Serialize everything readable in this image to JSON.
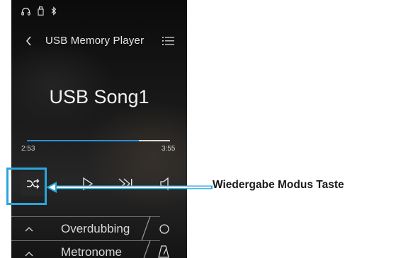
{
  "status_bar": {
    "icons": [
      "headphones-icon",
      "usb-icon",
      "bluetooth-icon"
    ]
  },
  "header": {
    "back_icon": "chevron-left-icon",
    "title": "USB Memory Player",
    "list_icon": "list-icon"
  },
  "song": {
    "title": "USB Song1"
  },
  "progress": {
    "elapsed": "2:53",
    "total": "3:55",
    "fraction": 0.78
  },
  "transport": {
    "mode_icon": "shuffle-icon",
    "play_icon": "play-icon",
    "forward_icon": "fast-forward-icon",
    "volume_icon": "speaker-icon"
  },
  "options": [
    {
      "label": "Overdubbing",
      "chevron": "chevron-up-icon",
      "icon": "record-circle-icon"
    },
    {
      "label": "Metronome",
      "chevron": "chevron-up-icon",
      "icon": "metronome-icon"
    }
  ],
  "callout": {
    "label": "Wiedergabe Modus Taste"
  },
  "colors": {
    "accent": "#2aa6dc",
    "progress": "#2b8fd8",
    "screen_bg": "#141414"
  }
}
